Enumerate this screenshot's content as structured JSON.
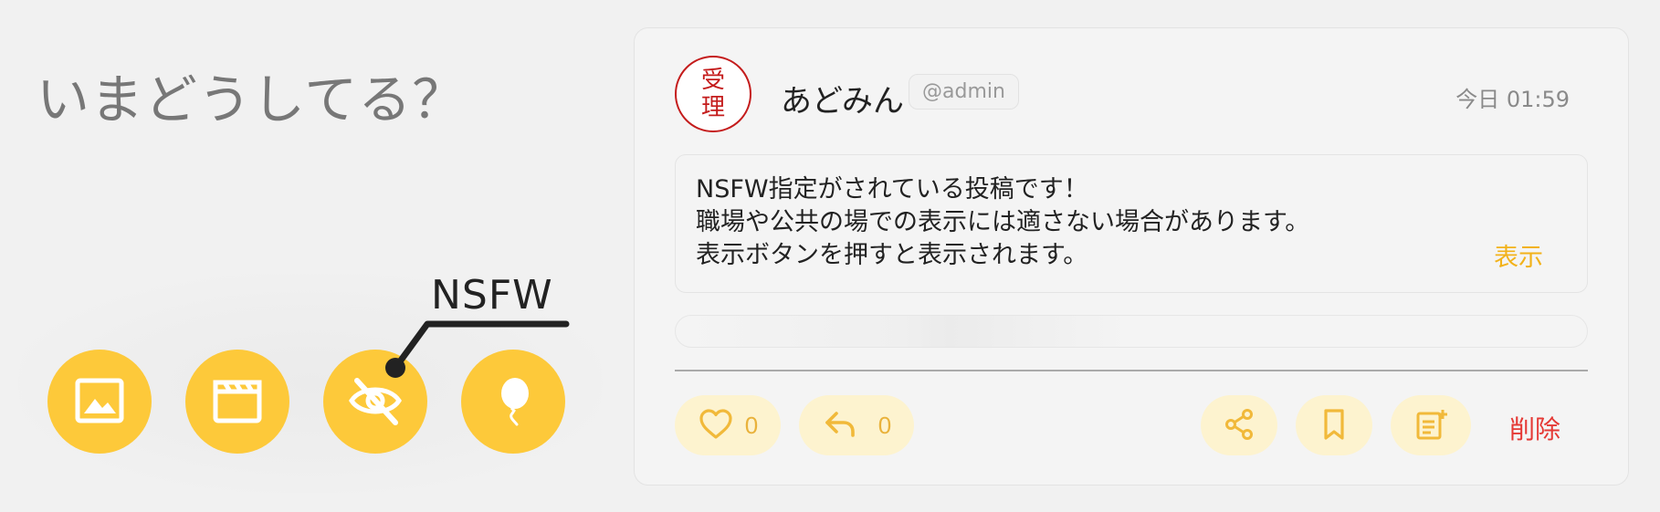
{
  "composer": {
    "prompt": "いまどうしてる？",
    "callout_label": "NSFW",
    "tools": [
      {
        "icon": "image-icon"
      },
      {
        "icon": "video-icon"
      },
      {
        "icon": "eye-off-icon"
      },
      {
        "icon": "balloon-icon"
      }
    ]
  },
  "post": {
    "avatar": {
      "stamp_text": "受理",
      "color": "#c41c1c"
    },
    "username": "あどみん",
    "handle": "@admin",
    "timestamp": "今日 01:59",
    "nsfw_notice": "NSFW指定がされている投稿です！\n職場や公共の場での表示には適さない場合があります。\n表示ボタンを押すと表示されます。",
    "show_label": "表示",
    "actions": {
      "like_count": "0",
      "reply_count": "0",
      "delete_label": "削除"
    }
  },
  "colors": {
    "accent": "#fdc93a",
    "accent_text": "#f2b21a",
    "pill_bg": "#fdf3cf",
    "danger": "#e53935"
  }
}
